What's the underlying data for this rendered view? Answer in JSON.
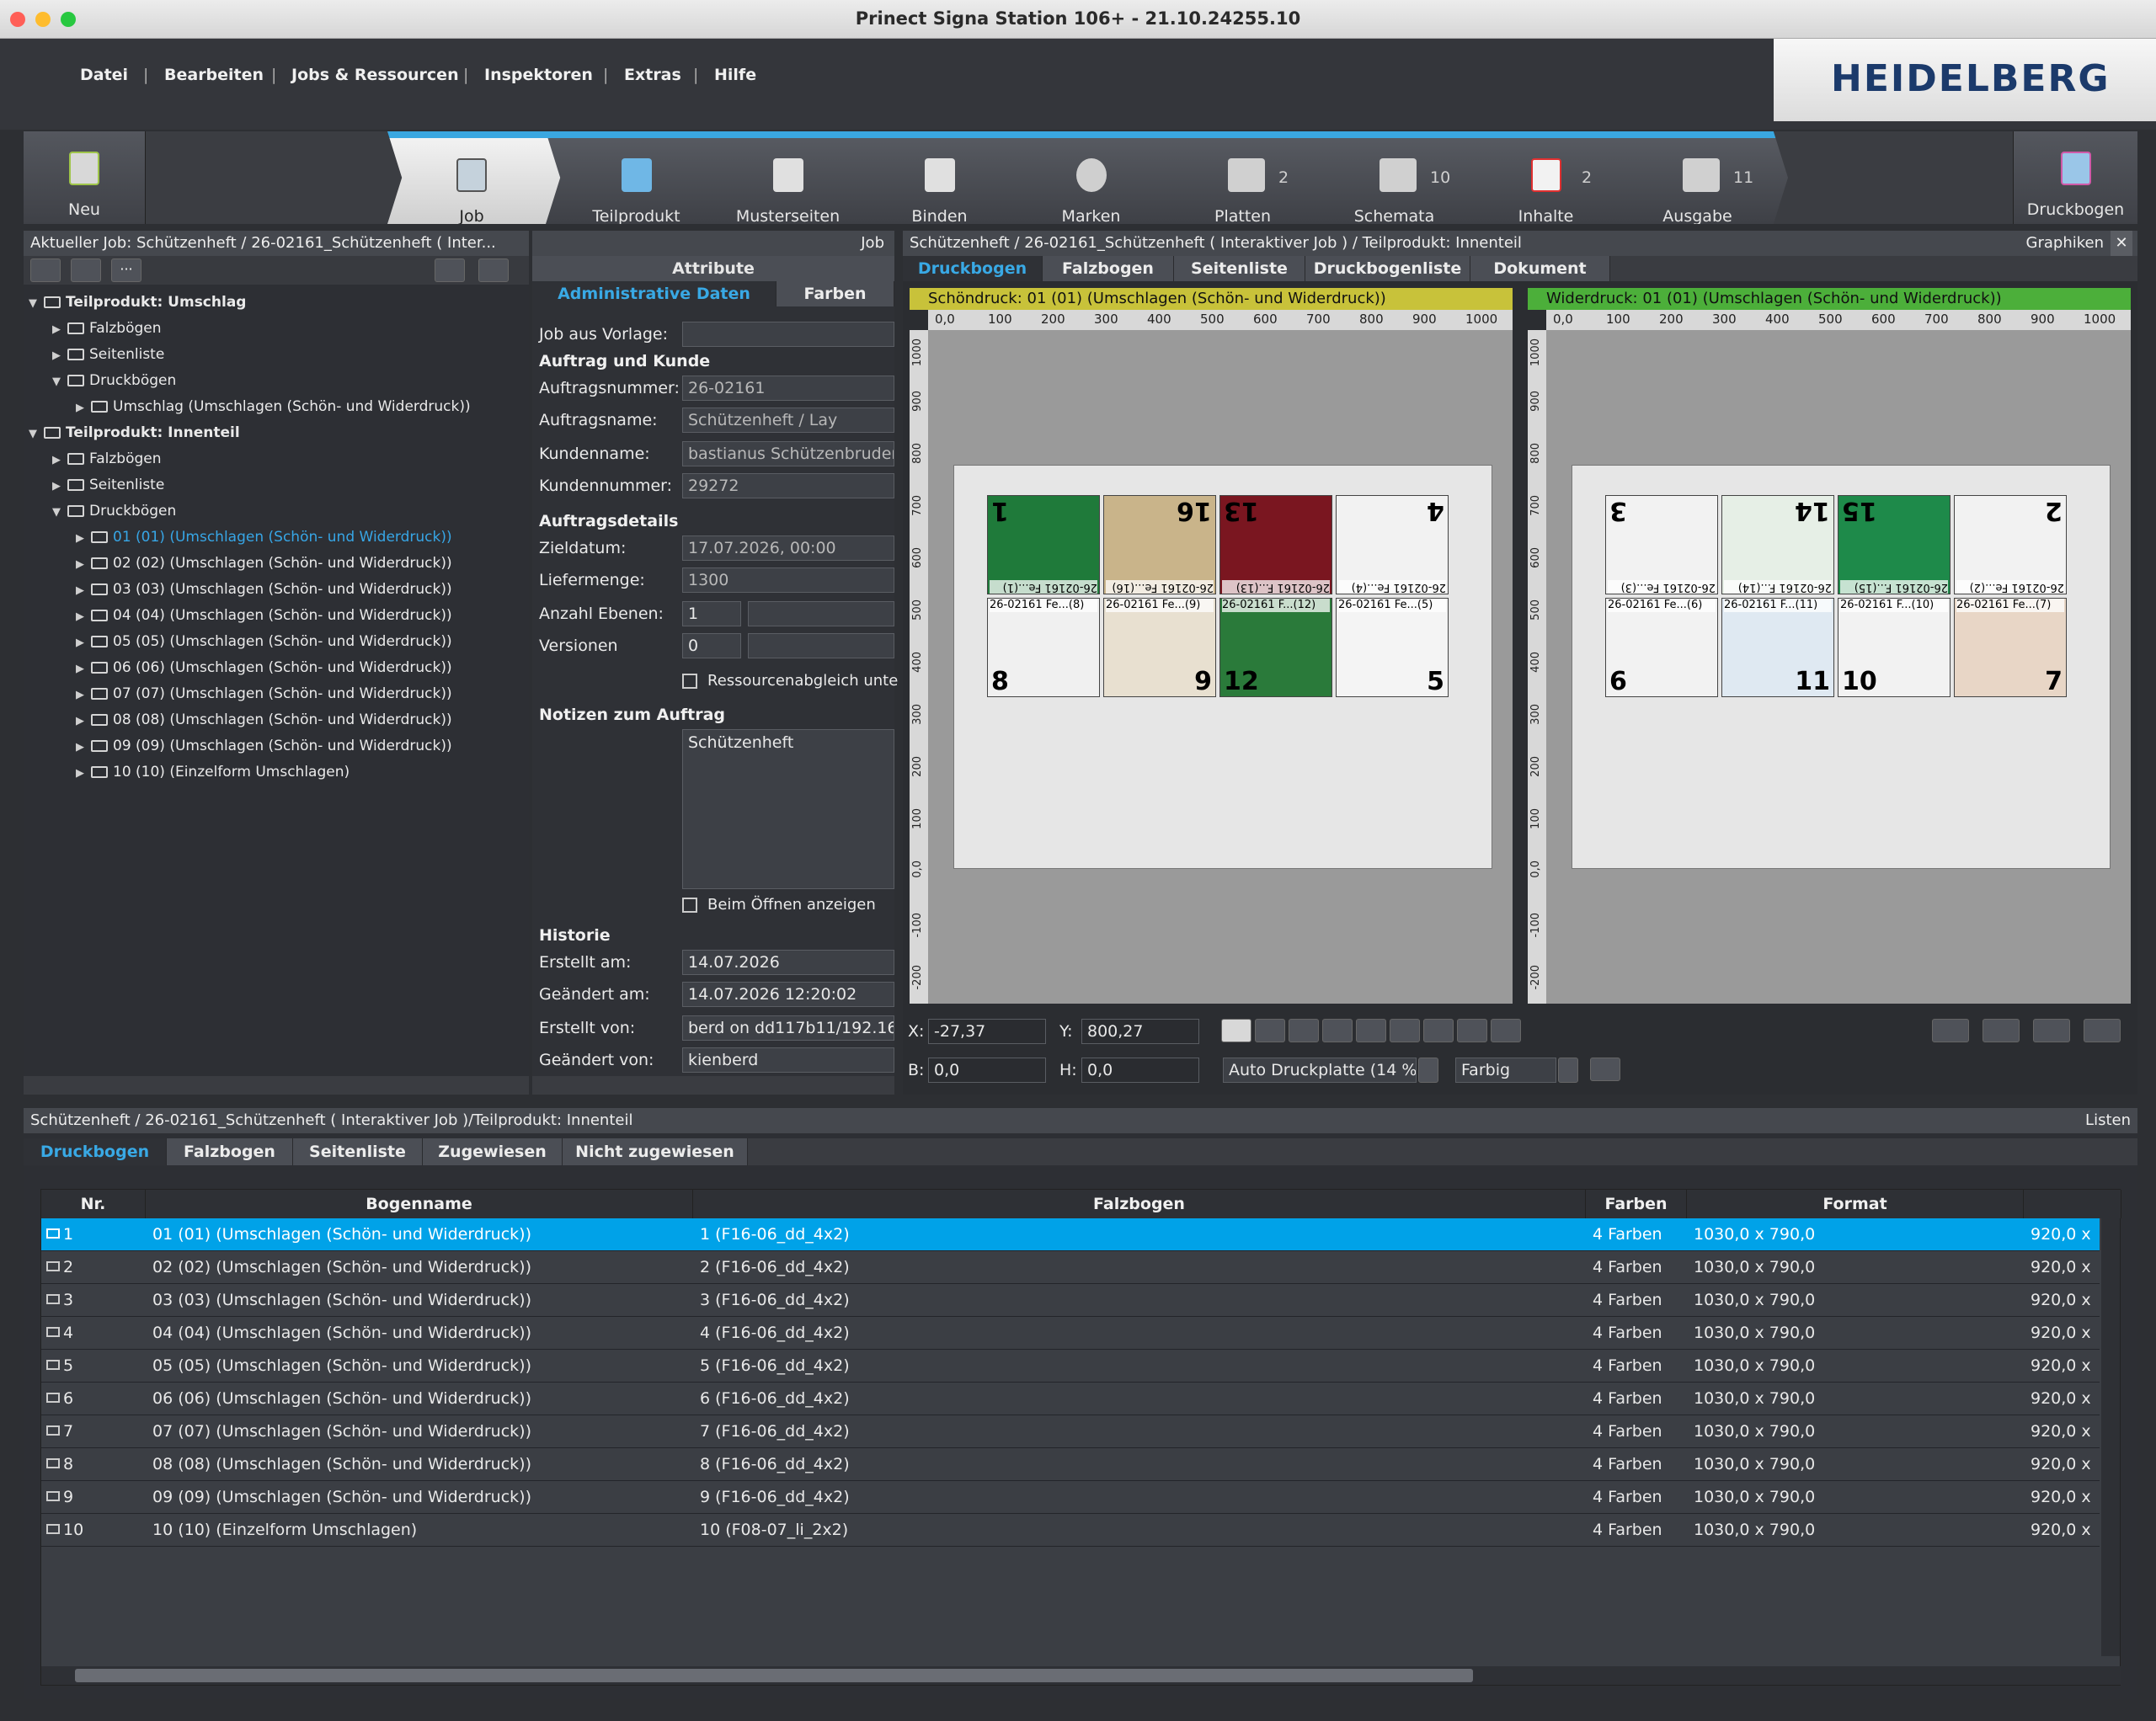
{
  "window": {
    "title": "Prinect Signa Station 106+  -  21.10.24255.10"
  },
  "menu": [
    "Datei",
    "Bearbeiten",
    "Jobs & Ressourcen",
    "Inspektoren",
    "Extras",
    "Hilfe"
  ],
  "brand": {
    "logo_text": "HEIDELBERG",
    "color": "#1b3a6b"
  },
  "toolbar": {
    "new_label": "Neu",
    "steps": [
      {
        "label": "Job",
        "count": ""
      },
      {
        "label": "Teilprodukt",
        "count": ""
      },
      {
        "label": "Musterseiten",
        "count": ""
      },
      {
        "label": "Binden",
        "count": ""
      },
      {
        "label": "Marken",
        "count": ""
      },
      {
        "label": "Platten",
        "count": "2"
      },
      {
        "label": "Schemata",
        "count": "10"
      },
      {
        "label": "Inhalte",
        "count": "2"
      },
      {
        "label": "Ausgabe",
        "count": "11"
      }
    ],
    "druckbogen_label": "Druckbogen"
  },
  "left_panel": {
    "header": "Aktueller Job: Schützenheft / 26-02161_Schützenheft ( Inter...",
    "tree": [
      {
        "label": "Teilprodukt: Umschlag",
        "bold": true
      },
      {
        "label": "Falzbögen"
      },
      {
        "label": "Seitenliste"
      },
      {
        "label": "Druckbögen"
      },
      {
        "label": "Umschlag (Umschlagen (Schön- und Widerdruck))"
      },
      {
        "label": "Teilprodukt: Innenteil",
        "bold": true
      },
      {
        "label": "Falzbögen"
      },
      {
        "label": "Seitenliste"
      },
      {
        "label": "Druckbögen"
      },
      {
        "label": "01 (01) (Umschlagen (Schön- und Widerdruck))"
      },
      {
        "label": "02 (02) (Umschlagen (Schön- und Widerdruck))"
      },
      {
        "label": "03 (03) (Umschlagen (Schön- und Widerdruck))"
      },
      {
        "label": "04 (04) (Umschlagen (Schön- und Widerdruck))"
      },
      {
        "label": "05 (05) (Umschlagen (Schön- und Widerdruck))"
      },
      {
        "label": "06 (06) (Umschlagen (Schön- und Widerdruck))"
      },
      {
        "label": "07 (07) (Umschlagen (Schön- und Widerdruck))"
      },
      {
        "label": "08 (08) (Umschlagen (Schön- und Widerdruck))"
      },
      {
        "label": "09 (09) (Umschlagen (Schön- und Widerdruck))"
      },
      {
        "label": "10 (10) (Einzelform Umschlagen)"
      }
    ]
  },
  "mid_panel": {
    "header": "Job",
    "section": "Attribute",
    "tabs": [
      "Administrative Daten",
      "Farben"
    ],
    "job_aus_vorlage_label": "Job aus Vorlage:",
    "auftrag_und_kunde": "Auftrag und Kunde",
    "auftragsnummer_label": "Auftragsnummer:",
    "auftragsnummer": "26-02161",
    "auftragsname_label": "Auftragsname:",
    "auftragsname": "Schützenheft / Lay",
    "kundenname_label": "Kundenname:",
    "kundenname": "bastianus Schützenbruderscl",
    "kundennummer_label": "Kundennummer:",
    "kundennummer": "29272",
    "auftragsdetails": "Auftragsdetails",
    "zieldatum_label": "Zieldatum:",
    "zieldatum": "17.07.2026, 00:00",
    "liefermenge_label": "Liefermenge:",
    "liefermenge": "1300",
    "anzahl_ebenen_label": "Anzahl Ebenen:",
    "anzahl_ebenen": "1",
    "versionen_label": "Versionen",
    "versionen": "0",
    "ressourcenabgleich": "Ressourcenabgleich unte",
    "notizen_label": "Notizen zum Auftrag",
    "notizen": "Schützenheft",
    "beim_oeffnen": "Beim Öffnen anzeigen",
    "historie": "Historie",
    "erstellt_am_label": "Erstellt am:",
    "erstellt_am": "14.07.2026",
    "geaendert_am_label": "Geändert am:",
    "geaendert_am": "14.07.2026   12:20:02",
    "erstellt_von_label": "Erstellt von:",
    "erstellt_von": "berd on dd117b11/192.16",
    "geaendert_von_label": "Geändert von:",
    "geaendert_von": "kienberd"
  },
  "right_panel": {
    "header": "Schützenheft / 26-02161_Schützenheft ( Interaktiver Job ) / Teilprodukt: Innenteil",
    "graphics_label": "Graphiken",
    "tabs": [
      "Druckbogen",
      "Falzbogen",
      "Seitenliste",
      "Druckbogenliste",
      "Dokument"
    ],
    "front_label": "Schöndruck:  01 (01) (Umschlagen (Schön- und Widerdruck))",
    "back_label": "Widerdruck:  01 (01) (Umschlagen (Schön- und Widerdruck))",
    "ruler_ticks": [
      "0,0",
      "100",
      "200",
      "300",
      "400",
      "500",
      "600",
      "700",
      "800",
      "900",
      "1000"
    ],
    "vruler_ticks": [
      "1000",
      "900",
      "800",
      "700",
      "600",
      "500",
      "400",
      "300",
      "200",
      "100",
      "0,0",
      "-100",
      "-200"
    ],
    "front_top_pages": [
      "1",
      "16",
      "13",
      "4"
    ],
    "front_bottom_pages": [
      "8",
      "9",
      "12",
      "5"
    ],
    "back_top_pages": [
      "3",
      "14",
      "15",
      "2"
    ],
    "back_bottom_pages": [
      "6",
      "11",
      "10",
      "7"
    ],
    "front_top_slugs": [
      "26-02161 Fe...(1)",
      "26-02161 Fe...(16)",
      "26-02161 F...(13)",
      "26-02161 Fe...(4)"
    ],
    "front_bottom_slugs": [
      "26-02161 Fe...(8)",
      "26-02161 Fe...(9)",
      "26-02161 F...(12)",
      "26-02161 Fe...(5)"
    ],
    "back_top_slugs": [
      "26-02161 Fe...(3)",
      "26-02161 F...(14)",
      "26-02161 F...(15)",
      "26-02161 Fe...(2)"
    ],
    "back_bottom_slugs": [
      "26-02161 Fe...(6)",
      "26-02161 F...(11)",
      "26-02161 F...(10)",
      "26-02161 Fe...(7)"
    ],
    "page_colors_front_top": [
      "#1f7a3a",
      "#c9b48a",
      "#7a1620",
      "#f2f2f2"
    ],
    "page_colors_front_bottom": [
      "#f0f0f0",
      "#e8e0d0",
      "#2a7a3a",
      "#f4f4f4"
    ],
    "page_colors_back_top": [
      "#f2f2f2",
      "#e6efe6",
      "#1e8a4a",
      "#f2f2f2"
    ],
    "page_colors_back_bottom": [
      "#f2f2f2",
      "#dfe9f2",
      "#f2f2f2",
      "#e8d6c6"
    ],
    "x_label": "X:",
    "x_value": "-27,37",
    "y_label": "Y:",
    "y_value": "800,27",
    "b_label": "B:",
    "b_value": "0,0",
    "h_label": "H:",
    "h_value": "0,0",
    "plate_select": "Auto Druckplatte (14 %)",
    "color_select": "Farbig"
  },
  "bottom_panel": {
    "header": "Schützenheft / 26-02161_Schützenheft ( Interaktiver Job )/Teilprodukt: Innenteil",
    "lists_label": "Listen",
    "tabs": [
      "Druckbogen",
      "Falzbogen",
      "Seitenliste",
      "Zugewiesen",
      "Nicht zugewiesen"
    ],
    "columns": [
      "Nr.",
      "Bogenname",
      "Falzbogen",
      "Farben",
      "Format"
    ],
    "rows": [
      {
        "nr": "1",
        "name": "01 (01) (Umschlagen (Schön- und Widerdruck))",
        "falz": "1 (F16-06_dd_4x2)",
        "farben": "4 Farben",
        "format": "1030,0 x 790,0",
        "extra": "920,0 x"
      },
      {
        "nr": "2",
        "name": "02 (02) (Umschlagen (Schön- und Widerdruck))",
        "falz": "2 (F16-06_dd_4x2)",
        "farben": "4 Farben",
        "format": "1030,0 x 790,0",
        "extra": "920,0 x"
      },
      {
        "nr": "3",
        "name": "03 (03) (Umschlagen (Schön- und Widerdruck))",
        "falz": "3 (F16-06_dd_4x2)",
        "farben": "4 Farben",
        "format": "1030,0 x 790,0",
        "extra": "920,0 x"
      },
      {
        "nr": "4",
        "name": "04 (04) (Umschlagen (Schön- und Widerdruck))",
        "falz": "4 (F16-06_dd_4x2)",
        "farben": "4 Farben",
        "format": "1030,0 x 790,0",
        "extra": "920,0 x"
      },
      {
        "nr": "5",
        "name": "05 (05) (Umschlagen (Schön- und Widerdruck))",
        "falz": "5 (F16-06_dd_4x2)",
        "farben": "4 Farben",
        "format": "1030,0 x 790,0",
        "extra": "920,0 x"
      },
      {
        "nr": "6",
        "name": "06 (06) (Umschlagen (Schön- und Widerdruck))",
        "falz": "6 (F16-06_dd_4x2)",
        "farben": "4 Farben",
        "format": "1030,0 x 790,0",
        "extra": "920,0 x"
      },
      {
        "nr": "7",
        "name": "07 (07) (Umschlagen (Schön- und Widerdruck))",
        "falz": "7 (F16-06_dd_4x2)",
        "farben": "4 Farben",
        "format": "1030,0 x 790,0",
        "extra": "920,0 x"
      },
      {
        "nr": "8",
        "name": "08 (08) (Umschlagen (Schön- und Widerdruck))",
        "falz": "8 (F16-06_dd_4x2)",
        "farben": "4 Farben",
        "format": "1030,0 x 790,0",
        "extra": "920,0 x"
      },
      {
        "nr": "9",
        "name": "09 (09) (Umschlagen (Schön- und Widerdruck))",
        "falz": "9 (F16-06_dd_4x2)",
        "farben": "4 Farben",
        "format": "1030,0 x 790,0",
        "extra": "920,0 x"
      },
      {
        "nr": "10",
        "name": "10 (10) (Einzelform Umschlagen)",
        "falz": "10 (F08-07_li_2x2)",
        "farben": "4 Farben",
        "format": "1030,0 x 790,0",
        "extra": "920,0 x"
      }
    ]
  },
  "colors": {
    "accent": "#00a2e8",
    "selected_text": "#37a6e6",
    "front_bar": "#c8c23a",
    "back_bar": "#4caf3a"
  }
}
